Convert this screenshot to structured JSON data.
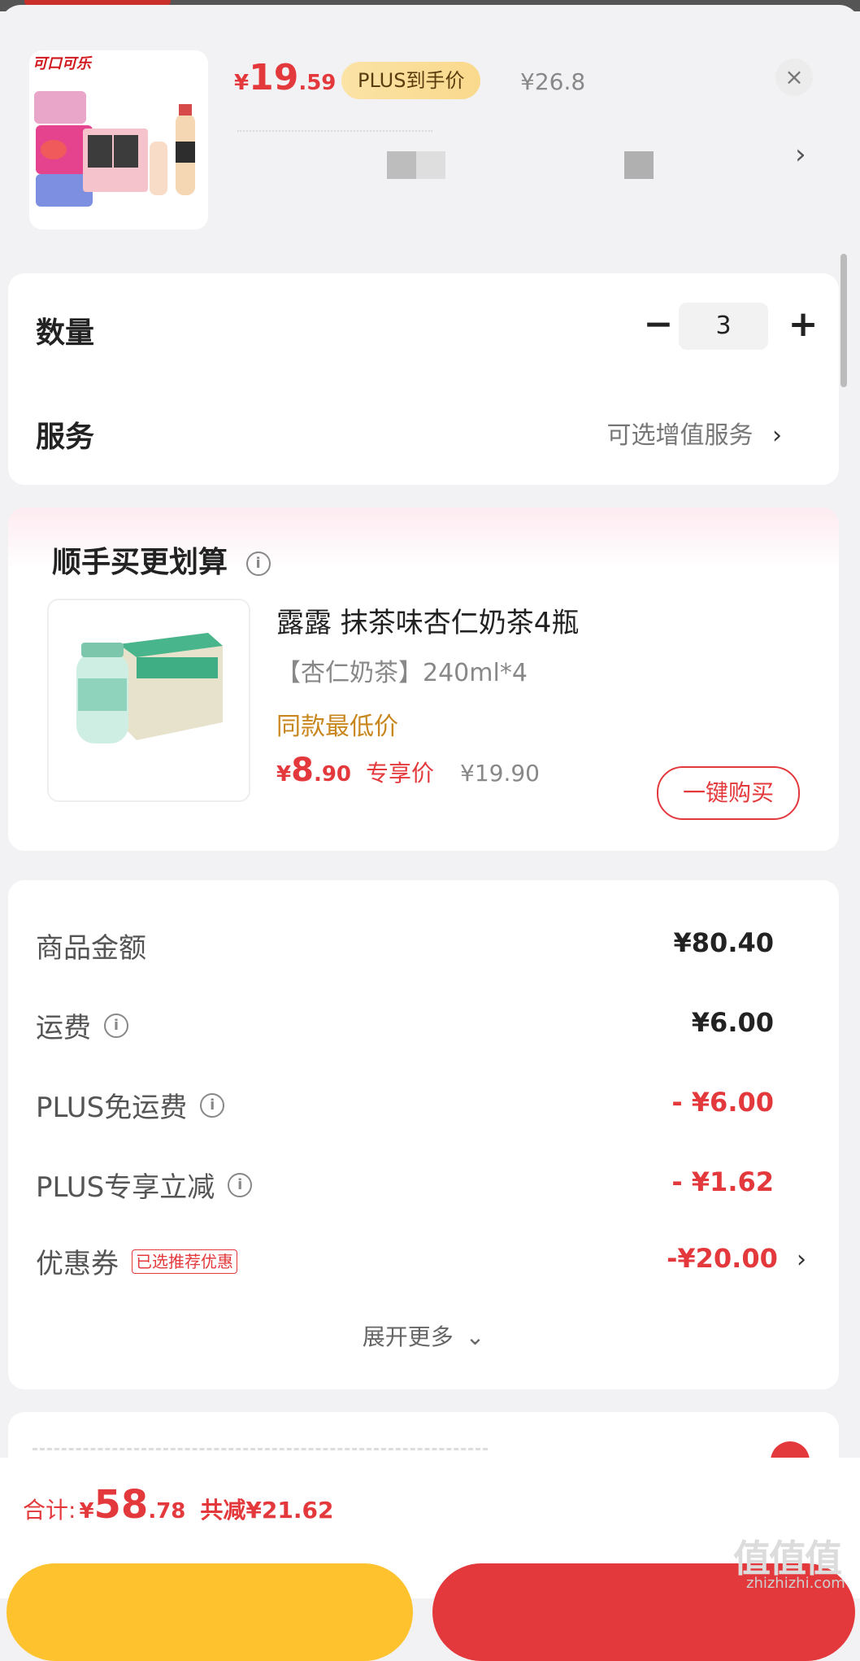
{
  "product": {
    "brand_logo_text": "可口可乐",
    "price_symbol": "¥",
    "price_int": "19",
    "price_dec": ".59",
    "plus_tag": "PLUS到手价",
    "orig_price": "¥26.8",
    "close_icon": "×",
    "spec_chevron": "›"
  },
  "options": {
    "quantity_label": "数量",
    "minus": "−",
    "quantity_value": "3",
    "plus": "+",
    "service_label": "服务",
    "service_value": "可选增值服务",
    "service_chevron": "›"
  },
  "recommend": {
    "title": "顺手买更划算",
    "info_icon": "i",
    "item_name": "露露 抹茶味杏仁奶茶4瓶",
    "item_spec": "【杏仁奶茶】240ml*4",
    "low_price_tag": "同款最低价",
    "price_symbol": "¥",
    "price_int": "8",
    "price_dec": ".90",
    "exclusive_label": "专享价",
    "orig_price": "¥19.90",
    "buy_button": "一键购买"
  },
  "summary": {
    "rows": [
      {
        "label": "商品金额",
        "value": "¥80.40"
      },
      {
        "label": "运费",
        "value": "¥6.00"
      },
      {
        "label": "PLUS免运费",
        "value": "- ¥6.00"
      },
      {
        "label": "PLUS专享立减",
        "value": "- ¥1.62"
      },
      {
        "label": "优惠券",
        "value": "-¥20.00"
      }
    ],
    "coupon_tag": "已选推荐优惠",
    "coupon_chevron": "›",
    "expand_more": "展开更多",
    "expand_icon": "⌄"
  },
  "footer": {
    "total_label": "合计:",
    "total_symbol": "¥",
    "total_int": "58",
    "total_dec": ".78",
    "total_save": "共减¥21.62"
  },
  "watermark": {
    "text": "值值值",
    "url": "zhizhizhi.com"
  },
  "colors": {
    "accent_red": "#e4393c",
    "plus_gold": "#f9d98c",
    "low_price_orange": "#c8861c",
    "yellow_button": "#fdc22d"
  }
}
